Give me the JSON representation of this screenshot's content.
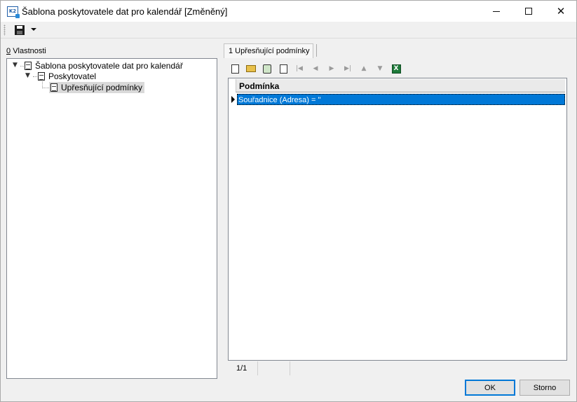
{
  "window": {
    "title": "Šablona poskytovatele dat pro kalendář [Změněný]",
    "app_icon_text": "K2",
    "minimize": "—",
    "maximize": "□",
    "close": "✕"
  },
  "toolbar": {
    "save_icon": "floppy-disk-icon",
    "dropdown_icon": "chevron-down-icon"
  },
  "left_panel": {
    "label": "Vlastnosti",
    "label_hotkey": "0",
    "tree": [
      {
        "label": "Šablona poskytovatele dat pro kalendář",
        "level": 0,
        "expanded": true
      },
      {
        "label": "Poskytovatel",
        "level": 1,
        "expanded": true
      },
      {
        "label": "Upřesňující podmínky",
        "level": 2,
        "selected": true
      }
    ]
  },
  "right_panel": {
    "tab_label": "1 Upřesňující podmínky",
    "toolbar_icons": [
      "new-icon",
      "open-folder-icon",
      "filter-icon",
      "refresh-icon",
      "first-icon",
      "prev-icon",
      "next-icon",
      "last-icon",
      "move-up-icon",
      "move-down-icon",
      "excel-export-icon"
    ],
    "grid": {
      "columns": [
        "Podmínka"
      ],
      "rows": [
        "Souřadnice (Adresa) = ''"
      ]
    },
    "status": {
      "count": "1/1"
    }
  },
  "buttons": {
    "ok": "OK",
    "cancel": "Storno"
  }
}
